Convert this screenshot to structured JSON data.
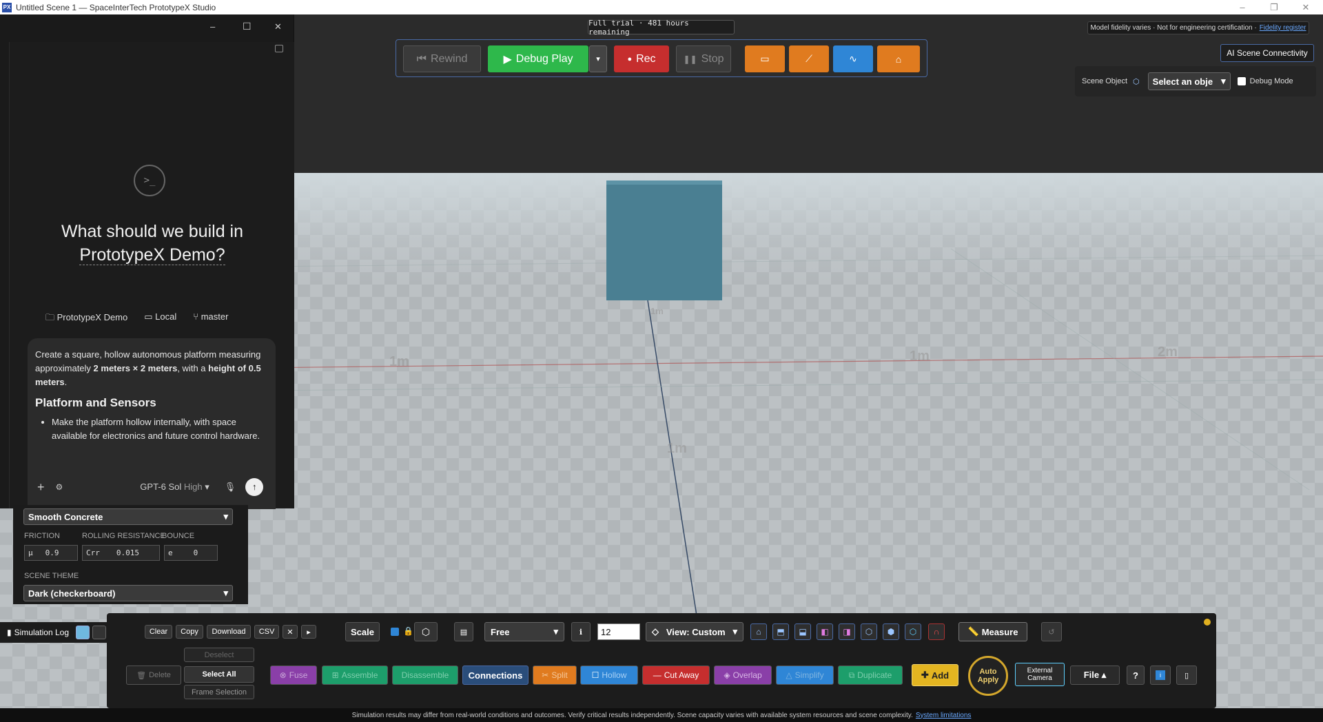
{
  "window": {
    "title": "Untitled Scene 1 — SpaceInterTech PrototypeX Studio",
    "logo": "PX",
    "min": "–",
    "max": "❐",
    "close": "✕"
  },
  "banner": {
    "trial": "Full trial · 481 hours remaining",
    "fidelity_text": "Model fidelity varies · Not for engineering certification ·",
    "fidelity_link": "Fidelity register"
  },
  "toolbar": {
    "rewind": "Rewind",
    "debug_play": "Debug Play",
    "rec": "Rec",
    "stop": "Stop"
  },
  "ai_connectivity": "AI Scene Connectivity",
  "scene_object": {
    "label": "Scene Object",
    "select": "Select an obje",
    "debug": "Debug Mode"
  },
  "grid_labels": [
    "1m",
    "1m",
    "2m",
    "1m",
    "1m"
  ],
  "chat": {
    "win_min": "–",
    "win_max": "☐",
    "win_close": "✕",
    "heading_1": "What should we build in",
    "heading_2": "PrototypeX Demo?",
    "project": "PrototypeX Demo",
    "env": "Local",
    "branch": "master",
    "prompt_p1_a": "Create a square, hollow autonomous platform measuring approximately ",
    "prompt_p1_b": "2 meters × 2 meters",
    "prompt_p1_c": ", with a ",
    "prompt_p1_d": "height of 0.5 meters",
    "prompt_p1_e": ".",
    "prompt_h": "Platform and Sensors",
    "prompt_li": "Make the platform hollow internally, with space available for electronics and future control hardware.",
    "model": "GPT-6 Sol",
    "effort": "High",
    "add": "+",
    "send": "↑"
  },
  "properties": {
    "material": "Smooth Concrete",
    "friction_label": "FRICTION",
    "rolling_label": "ROLLING RESISTANCE",
    "bounce_label": "BOUNCE",
    "mu": "μ",
    "mu_val": "0.9",
    "crr": "Crr",
    "crr_val": "0.015",
    "e": "e",
    "e_val": "0",
    "theme_label": "SCENE THEME",
    "theme": "Dark (checkerboard)"
  },
  "bottom": {
    "sim_log": "Simulation Log",
    "clear": "Clear",
    "copy": "Copy",
    "download": "Download",
    "csv": "CSV",
    "x": "✕",
    "play": "▸",
    "scale": "Scale",
    "free": "Free",
    "grid_num": "12",
    "view": "View: Custom",
    "measure": "Measure",
    "deselect": "Deselect",
    "delete": "Delete",
    "select_all": "Select All",
    "frame_selection": "Frame Selection",
    "fuse": "Fuse",
    "assemble": "Assemble",
    "disassemble": "Disassemble",
    "connections": "Connections",
    "split": "Split",
    "hollow": "Hollow",
    "cut_away": "Cut Away",
    "overlap": "Overlap",
    "simplify": "Simplify",
    "duplicate": "Duplicate",
    "add": "Add",
    "auto_apply_1": "Auto",
    "auto_apply_2": "Apply",
    "ext_cam_1": "External",
    "ext_cam_2": "Camera",
    "file": "File ▴",
    "help": "?"
  },
  "footer": {
    "text": "Simulation results may differ from real-world conditions and outcomes. Verify critical results independently. Scene capacity varies with available system resources and scene complexity.",
    "link": "System limitations"
  },
  "colors": {
    "play": "#2eb84b",
    "rec": "#c62e2e",
    "orange": "#e07b1f",
    "blue": "#2f86d6",
    "cube": "#4a7f92",
    "accent": "#4a6aa5"
  }
}
